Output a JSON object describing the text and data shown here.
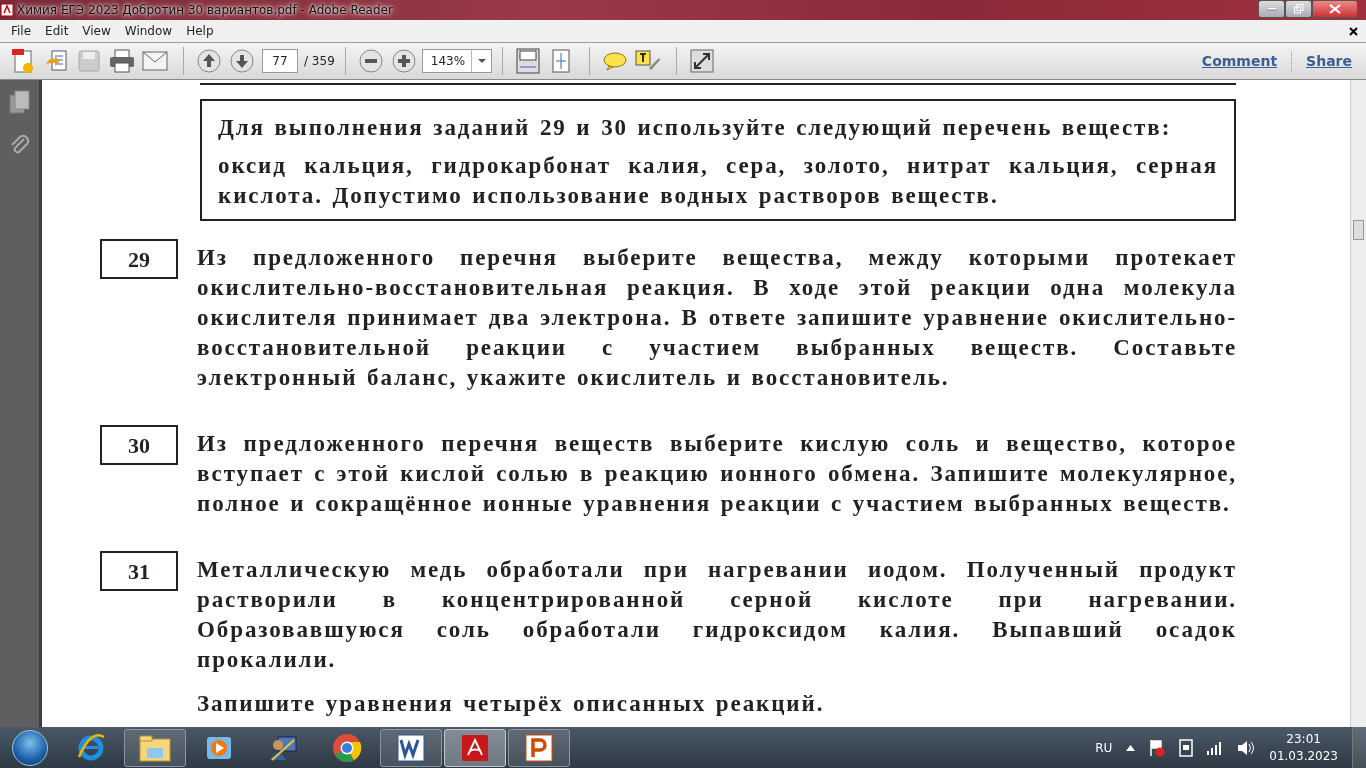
{
  "window": {
    "title": "Химия ЕГЭ 2023 Добротин 30 вариантов.pdf - Adobe Reader"
  },
  "menu": [
    "File",
    "Edit",
    "View",
    "Window",
    "Help"
  ],
  "toolbar": {
    "page_number": "77",
    "page_total": "/ 359",
    "zoom": "143%",
    "links": [
      "Comment",
      "Share"
    ]
  },
  "document": {
    "instruction_box": {
      "heading": "Для выполнения заданий 29 и 30 используйте следующий перечень веществ:",
      "text": "оксид кальция, гидрокарбонат калия, сера, золото, нитрат кальция, серная кислота. Допустимо использование водных растворов веществ."
    },
    "tasks": [
      {
        "number": "29",
        "paragraphs": [
          "Из предложенного перечня выберите вещества, между которыми протекает окислительно-восстановительная реакция. В ходе этой реакции одна молекула окислителя принимает два электрона. В ответе запишите уравнение окислительно-восстановительной реакции с участием выбранных веществ. Составьте электронный баланс, укажите окислитель и восстановитель."
        ]
      },
      {
        "number": "30",
        "paragraphs": [
          "Из предложенного перечня веществ выберите кислую соль и вещество, которое вступает с этой кислой солью в реакцию ионного обмена. Запишите молекулярное, полное и сокращённое ионные уравнения реакции с участием выбранных веществ."
        ]
      },
      {
        "number": "31",
        "paragraphs": [
          "Металлическую медь обработали при нагревании иодом. Полученный продукт растворили в концентрированной серной кислоте при нагревании. Образовавшуюся соль обработали гидроксидом калия. Выпавший осадок прокалили.",
          "Запишите уравнения четырёх описанных реакций."
        ]
      }
    ]
  },
  "taskbar": {
    "apps": [
      {
        "kind": "ie",
        "running": false,
        "selected": false
      },
      {
        "kind": "explorer",
        "running": true,
        "selected": false
      },
      {
        "kind": "media",
        "running": false,
        "selected": false
      },
      {
        "kind": "user",
        "running": false,
        "selected": false
      },
      {
        "kind": "chrome",
        "running": false,
        "selected": false
      },
      {
        "kind": "word",
        "running": true,
        "selected": false
      },
      {
        "kind": "acrobat",
        "running": true,
        "selected": true
      },
      {
        "kind": "powerpoint",
        "running": true,
        "selected": false
      }
    ],
    "language": "RU",
    "time": "23:01",
    "date": "01.03.2023"
  }
}
